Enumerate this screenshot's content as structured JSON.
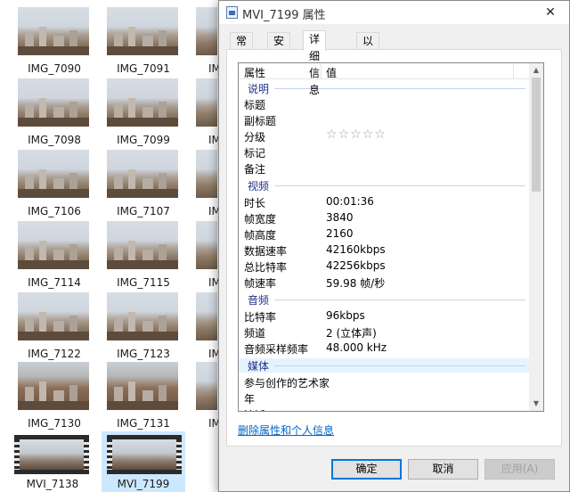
{
  "explorer": {
    "files": [
      {
        "name": "IMG_7090"
      },
      {
        "name": "IMG_7091"
      },
      {
        "name": "IMG_7098"
      },
      {
        "name": "IMG_7099"
      },
      {
        "name": "IMG_7106"
      },
      {
        "name": "IMG_7107"
      },
      {
        "name": "IMG_7114"
      },
      {
        "name": "IMG_7115"
      },
      {
        "name": "IMG_7122"
      },
      {
        "name": "IMG_7123"
      },
      {
        "name": "IMG_7130"
      },
      {
        "name": "IMG_7131"
      },
      {
        "name": "MVI_7138"
      },
      {
        "name": "MVI_7199"
      }
    ],
    "partial_labels": [
      "IM",
      "IM",
      "IM",
      "IM",
      "IM",
      "IM"
    ]
  },
  "dialog": {
    "title": "MVI_7199 属性",
    "close_glyph": "✕",
    "tabs": [
      "常规",
      "安全",
      "详细信息",
      "以前的版本"
    ],
    "active_tab": "详细信息",
    "list": {
      "col_name": "属性",
      "col_value": "值",
      "groups": {
        "description": "说明",
        "video": "视频",
        "audio": "音频",
        "media": "媒体"
      },
      "desc_rows": {
        "title": "标题",
        "subtitle": "副标题",
        "rating": "分级",
        "rating_stars": "☆☆☆☆☆",
        "tags": "标记",
        "comments": "备注"
      },
      "video_rows": {
        "duration_k": "时长",
        "duration_v": "00:01:36",
        "width_k": "帧宽度",
        "width_v": "3840",
        "height_k": "帧高度",
        "height_v": "2160",
        "datarate_k": "数据速率",
        "datarate_v": "42160kbps",
        "bitrate_k": "总比特率",
        "bitrate_v": "42256kbps",
        "fps_k": "帧速率",
        "fps_v": "59.98 帧/秒"
      },
      "audio_rows": {
        "bitrate_k": "比特率",
        "bitrate_v": "96kbps",
        "channels_k": "频道",
        "channels_v": "2 (立体声)",
        "samplerate_k": "音频采样频率",
        "samplerate_v": "48.000 kHz"
      },
      "media_rows": {
        "artist_k": "参与创作的艺术家",
        "year_k": "年",
        "partial_k": "流派"
      }
    },
    "remove_link": "删除属性和个人信息",
    "buttons": {
      "ok": "确定",
      "cancel": "取消",
      "apply": "应用(A)"
    }
  }
}
